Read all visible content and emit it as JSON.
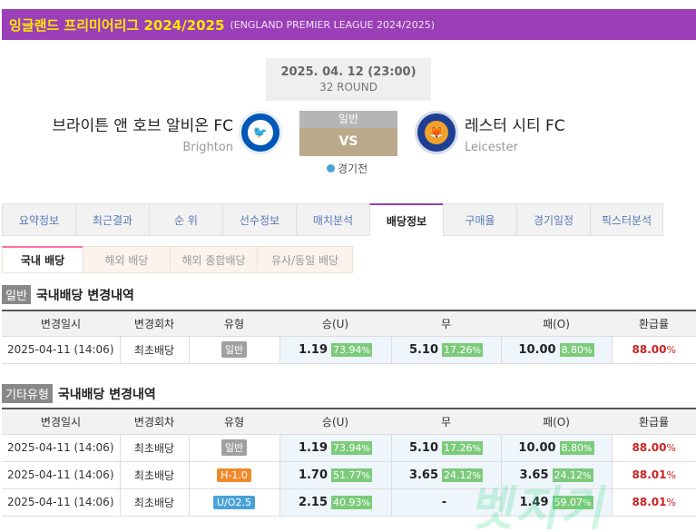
{
  "header": {
    "title": "잉글랜드 프리미어리그 2024/2025",
    "subtitle": "(ENGLAND PREMIER LEAGUE 2024/2025)"
  },
  "match": {
    "datetime": "2025. 04. 12 (23:00)",
    "round": "32 ROUND",
    "home": {
      "name": "브라이튼 앤 호브 알비온 FC",
      "en": "Brighton"
    },
    "away": {
      "name": "레스터 시티 FC",
      "en": "Leicester"
    },
    "type": "일반",
    "vs": "VS",
    "status": "경기전"
  },
  "tabs": [
    "요약정보",
    "최근결과",
    "순 위",
    "선수정보",
    "매치분석",
    "배당정보",
    "구매율",
    "경기일정",
    "픽스터분석"
  ],
  "subtabs": [
    "국내 배당",
    "해외 배당",
    "해외 종합배당",
    "유사/동일 배당"
  ],
  "columns": [
    "변경일시",
    "변경회차",
    "유형",
    "승(U)",
    "무",
    "패(O)",
    "환급률"
  ],
  "section1": {
    "tag": "일반",
    "title": "국내배당 변경내역",
    "rows": [
      {
        "date": "2025-04-11 (14:06)",
        "round": "최초배당",
        "type": "일반",
        "type_color": "gray",
        "win": "1.19",
        "win_pct": "73.94",
        "draw": "5.10",
        "draw_pct": "17.26",
        "lose": "10.00",
        "lose_pct": "8.80",
        "ret": "88.00"
      }
    ]
  },
  "section2": {
    "tag": "기타유형",
    "title": "국내배당 변경내역",
    "rows": [
      {
        "date": "2025-04-11 (14:06)",
        "round": "최초배당",
        "type": "일반",
        "type_color": "gray",
        "win": "1.19",
        "win_pct": "73.94",
        "draw": "5.10",
        "draw_pct": "17.26",
        "lose": "10.00",
        "lose_pct": "8.80",
        "ret": "88.00"
      },
      {
        "date": "2025-04-11 (14:06)",
        "round": "최초배당",
        "type": "H-1.0",
        "type_color": "orange",
        "win": "1.70",
        "win_pct": "51.77",
        "draw": "3.65",
        "draw_pct": "24.12",
        "lose": "3.65",
        "lose_pct": "24.12",
        "ret": "88.01"
      },
      {
        "date": "2025-04-11 (14:06)",
        "round": "최초배당",
        "type": "U/O2.5",
        "type_color": "blue",
        "win": "2.15",
        "win_pct": "40.93",
        "draw": "-",
        "draw_pct": "",
        "lose": "1.49",
        "lose_pct": "59.07",
        "ret": "88.01"
      }
    ]
  },
  "pct_unit": "%",
  "watermark": "벳지기"
}
